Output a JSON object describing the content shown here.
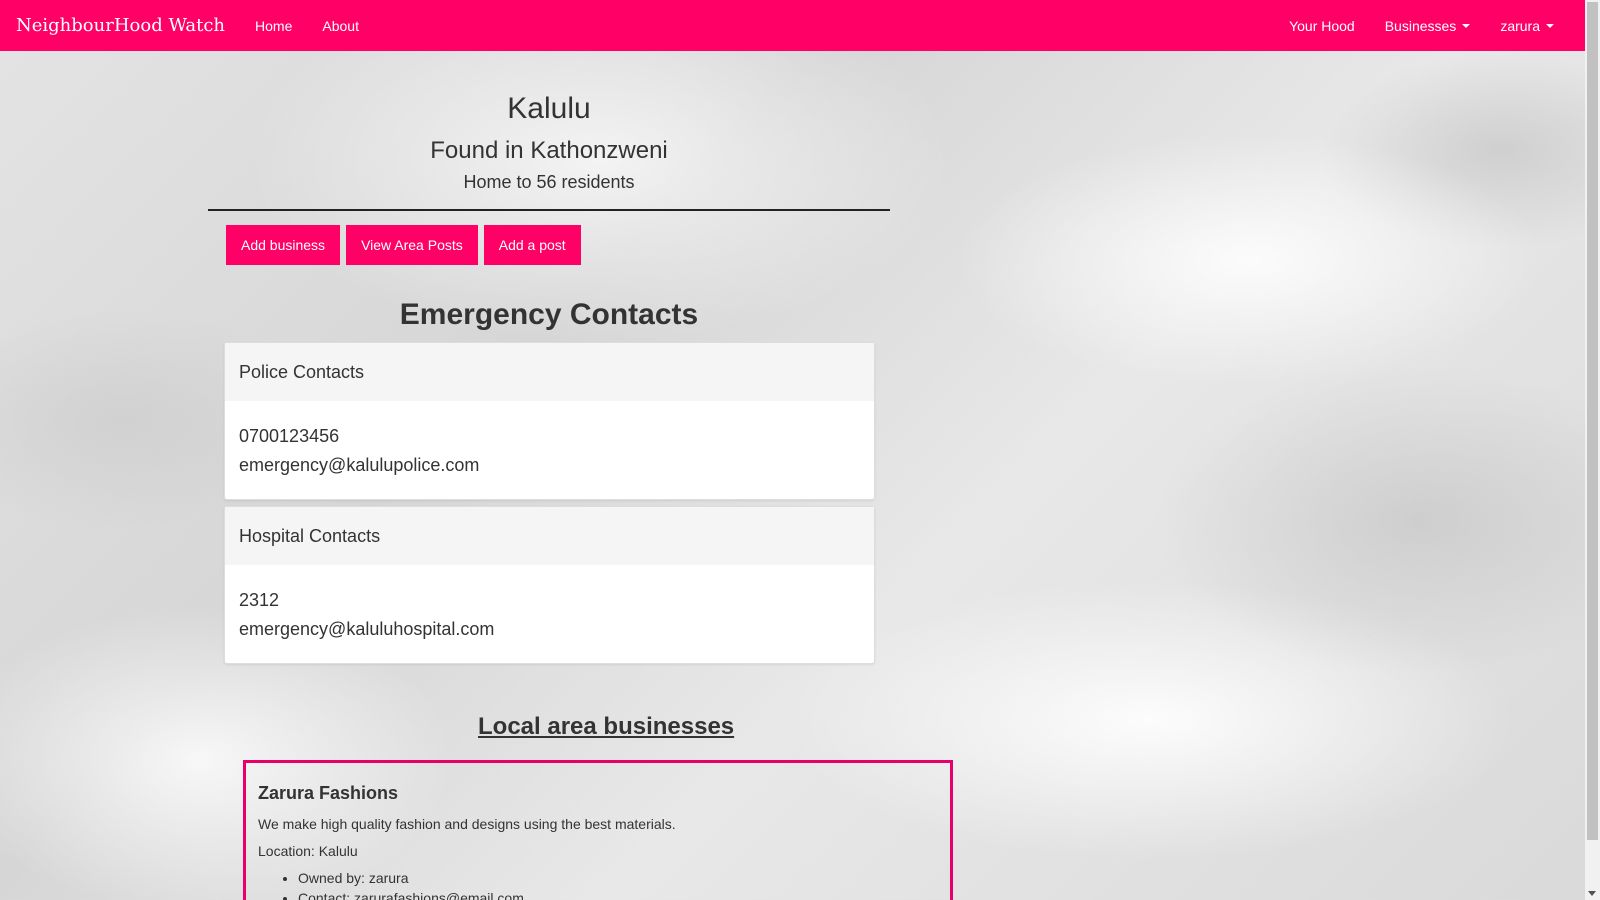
{
  "nav": {
    "brand": "NeighbourHood Watch",
    "left_links": [
      "Home",
      "About"
    ],
    "your_hood": "Your Hood",
    "businesses": "Businesses",
    "user": "zarura"
  },
  "hood": {
    "name": "Kalulu",
    "location": "Found in Kathonzweni",
    "residents": "Home to 56 residents"
  },
  "actions": {
    "add_business": "Add business",
    "view_posts": "View Area Posts",
    "add_post": "Add a post"
  },
  "emergency": {
    "title": "Emergency Contacts",
    "police": {
      "heading": "Police Contacts",
      "phone": "0700123456",
      "email": "emergency@kalulupolice.com"
    },
    "hospital": {
      "heading": "Hospital Contacts",
      "phone": "2312",
      "email": "emergency@kaluluhospital.com"
    }
  },
  "businesses": {
    "title": "Local area businesses",
    "items": [
      {
        "name": "Zarura Fashions",
        "description": "We make high quality fashion and designs using the best materials.",
        "location": "Location: Kalulu",
        "owner": "Owned by: zarura",
        "contact": "Contact: zarurafashions@email.com"
      }
    ]
  },
  "colors": {
    "accent": "#ff0066",
    "card_border": "#e6006b"
  }
}
